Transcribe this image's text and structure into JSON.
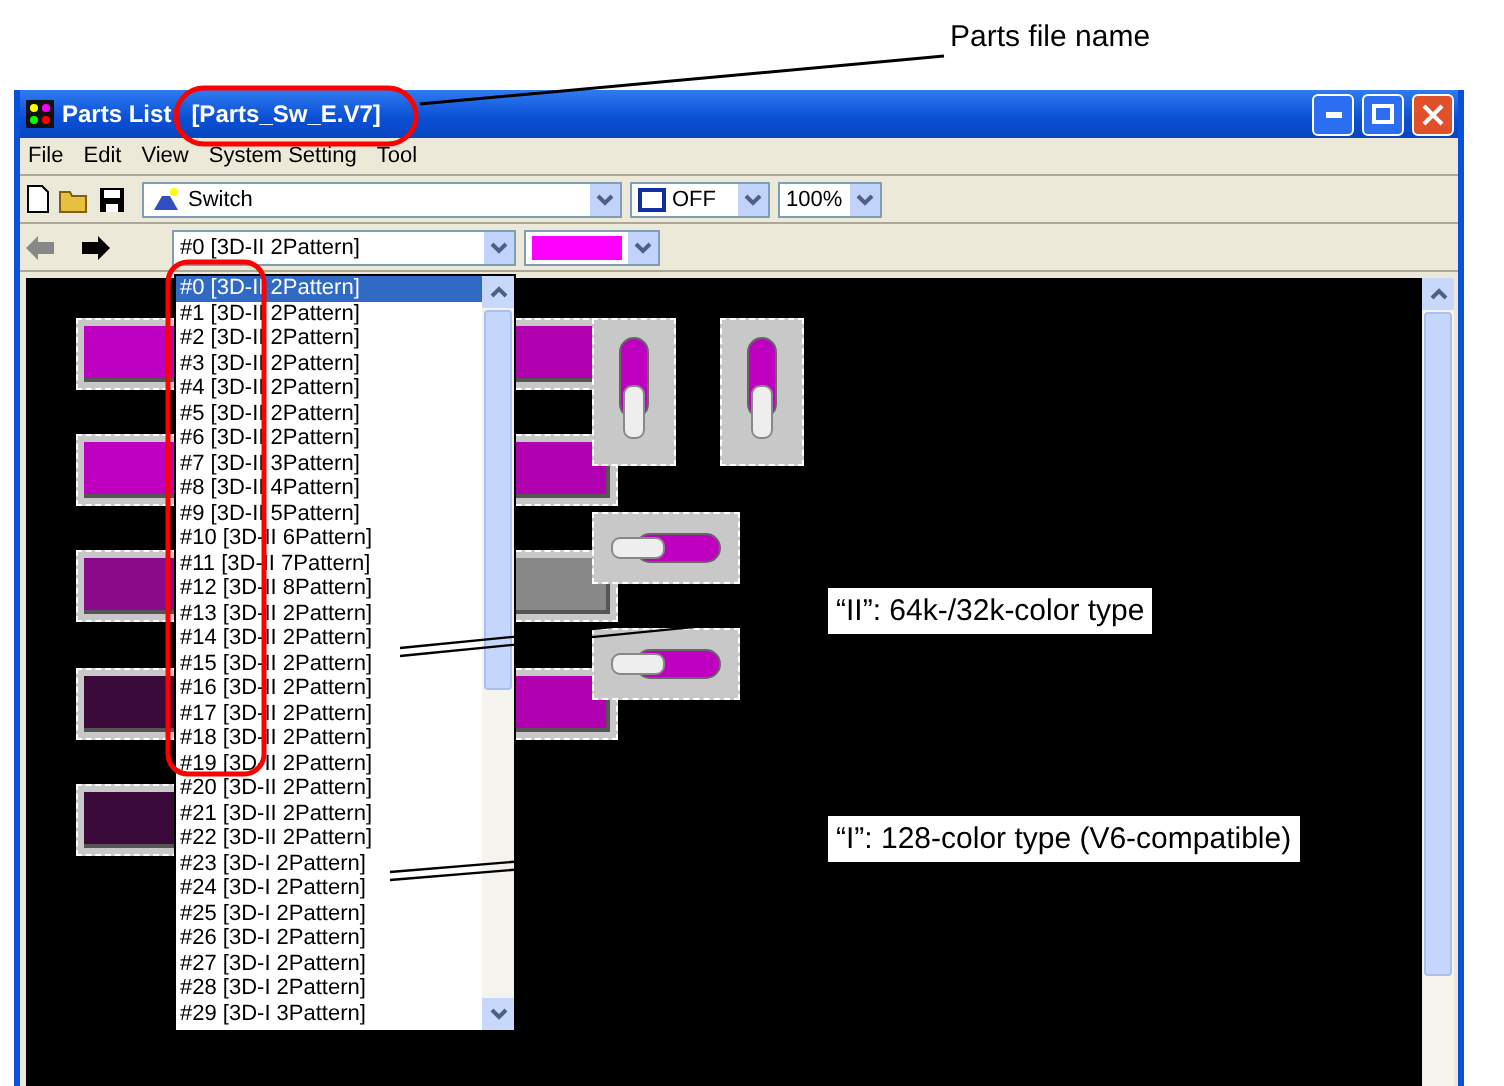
{
  "annotations": {
    "file_name": "Parts file name",
    "type_ii": "“II”: 64k-/32k-color type",
    "type_i": "“I”: 128-color type (V6-compatible)"
  },
  "window": {
    "title": "Parts List",
    "file": "[Parts_Sw_E.V7]"
  },
  "menu": [
    "File",
    "Edit",
    "View",
    "System Setting",
    "Tool"
  ],
  "toolbar": {
    "category": "Switch",
    "state": "OFF",
    "zoom": "100%"
  },
  "pattern_bar": {
    "pattern": "#0 [3D-II 2Pattern]",
    "color": "#ff00ff"
  },
  "pattern_list": [
    {
      "label": "#0 [3D-II 2Pattern]",
      "selected": true
    },
    {
      "label": "#1 [3D-II 2Pattern]",
      "selected": false
    },
    {
      "label": "#2 [3D-II 2Pattern]",
      "selected": false
    },
    {
      "label": "#3 [3D-II 2Pattern]",
      "selected": false
    },
    {
      "label": "#4 [3D-II 2Pattern]",
      "selected": false
    },
    {
      "label": "#5 [3D-II 2Pattern]",
      "selected": false
    },
    {
      "label": "#6 [3D-II 2Pattern]",
      "selected": false
    },
    {
      "label": "#7 [3D-II 3Pattern]",
      "selected": false
    },
    {
      "label": "#8 [3D-II 4Pattern]",
      "selected": false
    },
    {
      "label": "#9 [3D-II 5Pattern]",
      "selected": false
    },
    {
      "label": "#10 [3D-II 6Pattern]",
      "selected": false
    },
    {
      "label": "#11 [3D-II 7Pattern]",
      "selected": false
    },
    {
      "label": "#12 [3D-II 8Pattern]",
      "selected": false
    },
    {
      "label": "#13 [3D-II 2Pattern]",
      "selected": false
    },
    {
      "label": "#14 [3D-II 2Pattern]",
      "selected": false
    },
    {
      "label": "#15 [3D-II 2Pattern]",
      "selected": false
    },
    {
      "label": "#16 [3D-II 2Pattern]",
      "selected": false
    },
    {
      "label": "#17 [3D-II 2Pattern]",
      "selected": false
    },
    {
      "label": "#18 [3D-II 2Pattern]",
      "selected": false
    },
    {
      "label": "#19 [3D-II 2Pattern]",
      "selected": false
    },
    {
      "label": "#20 [3D-II 2Pattern]",
      "selected": false
    },
    {
      "label": "#21 [3D-II 2Pattern]",
      "selected": false
    },
    {
      "label": "#22 [3D-II 2Pattern]",
      "selected": false
    },
    {
      "label": "#23 [3D-I 2Pattern]",
      "selected": false
    },
    {
      "label": "#24 [3D-I 2Pattern]",
      "selected": false
    },
    {
      "label": "#25 [3D-I 2Pattern]",
      "selected": false
    },
    {
      "label": "#26 [3D-I 2Pattern]",
      "selected": false
    },
    {
      "label": "#27 [3D-I 2Pattern]",
      "selected": false
    },
    {
      "label": "#28 [3D-I 2Pattern]",
      "selected": false
    },
    {
      "label": "#29 [3D-I 3Pattern]",
      "selected": false
    }
  ]
}
